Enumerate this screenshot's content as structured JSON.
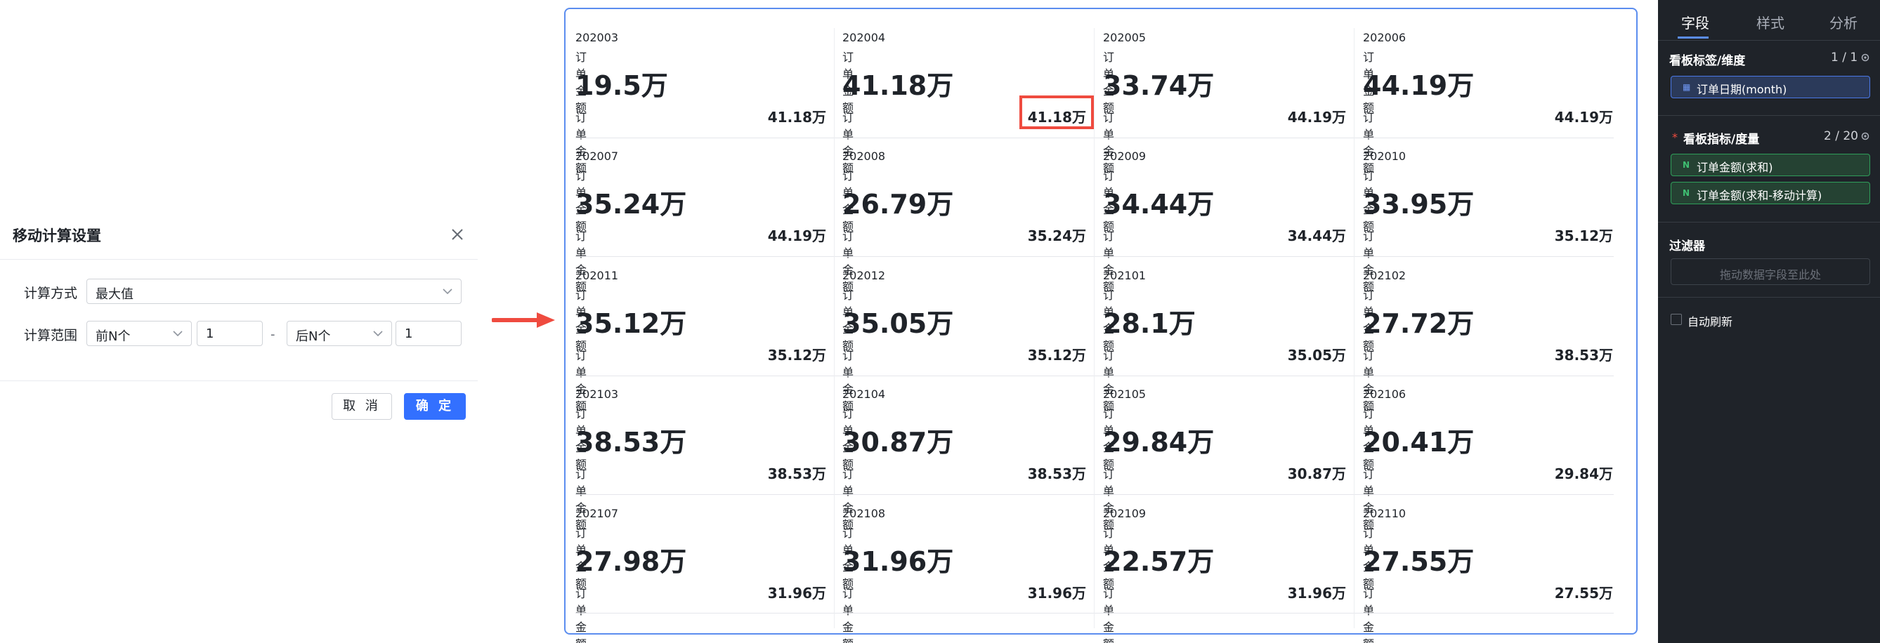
{
  "dialog": {
    "title": "移动计算设置",
    "method_label": "计算方式",
    "method_value": "最大值",
    "range_label": "计算范围",
    "range_before_select": "前N个",
    "range_before_value": "1",
    "range_dash": "-",
    "range_after_select": "后N个",
    "range_after_value": "1",
    "cancel_label": "取 消",
    "ok_label": "确 定"
  },
  "board": {
    "metric_label": "订单金额",
    "rows": [
      [
        {
          "period": "202003",
          "value": "19.5万",
          "sub": "41.18万"
        },
        {
          "period": "202004",
          "value": "41.18万",
          "sub": "41.18万"
        },
        {
          "period": "202005",
          "value": "33.74万",
          "sub": "44.19万"
        },
        {
          "period": "202006",
          "value": "44.19万",
          "sub": "44.19万"
        }
      ],
      [
        {
          "period": "202007",
          "value": "35.24万",
          "sub": "44.19万"
        },
        {
          "period": "202008",
          "value": "26.79万",
          "sub": "35.24万"
        },
        {
          "period": "202009",
          "value": "34.44万",
          "sub": "34.44万"
        },
        {
          "period": "202010",
          "value": "33.95万",
          "sub": "35.12万"
        }
      ],
      [
        {
          "period": "202011",
          "value": "35.12万",
          "sub": "35.12万"
        },
        {
          "period": "202012",
          "value": "35.05万",
          "sub": "35.12万"
        },
        {
          "period": "202101",
          "value": "28.1万",
          "sub": "35.05万"
        },
        {
          "period": "202102",
          "value": "27.72万",
          "sub": "38.53万"
        }
      ],
      [
        {
          "period": "202103",
          "value": "38.53万",
          "sub": "38.53万"
        },
        {
          "period": "202104",
          "value": "30.87万",
          "sub": "38.53万"
        },
        {
          "period": "202105",
          "value": "29.84万",
          "sub": "30.87万"
        },
        {
          "period": "202106",
          "value": "20.41万",
          "sub": "29.84万"
        }
      ],
      [
        {
          "period": "202107",
          "value": "27.98万",
          "sub": "31.96万"
        },
        {
          "period": "202108",
          "value": "31.96万",
          "sub": "31.96万"
        },
        {
          "period": "202109",
          "value": "22.57万",
          "sub": "31.96万"
        },
        {
          "period": "202110",
          "value": "27.55万",
          "sub": "27.55万"
        }
      ]
    ],
    "highlight_color": "#ef4b3f"
  },
  "panel": {
    "tabs": [
      "字段",
      "样式",
      "分析"
    ],
    "active_tab": "字段",
    "dimension_section": "看板标签/维度",
    "dimension_count": "1 / 1",
    "dimension_chip": "订单日期(month)",
    "measure_section": "看板指标/度量",
    "measure_count": "2 / 20",
    "measure_chips": [
      "订单金额(求和)",
      "订单金额(求和-移动计算)"
    ],
    "filter_section": "过滤器",
    "filter_placeholder": "拖动数据字段至此处",
    "auto_refresh_label": "自动刷新",
    "dimension_icon": "calendar-icon",
    "measure_icon": "number-icon",
    "accent_color": "#5b8def"
  }
}
